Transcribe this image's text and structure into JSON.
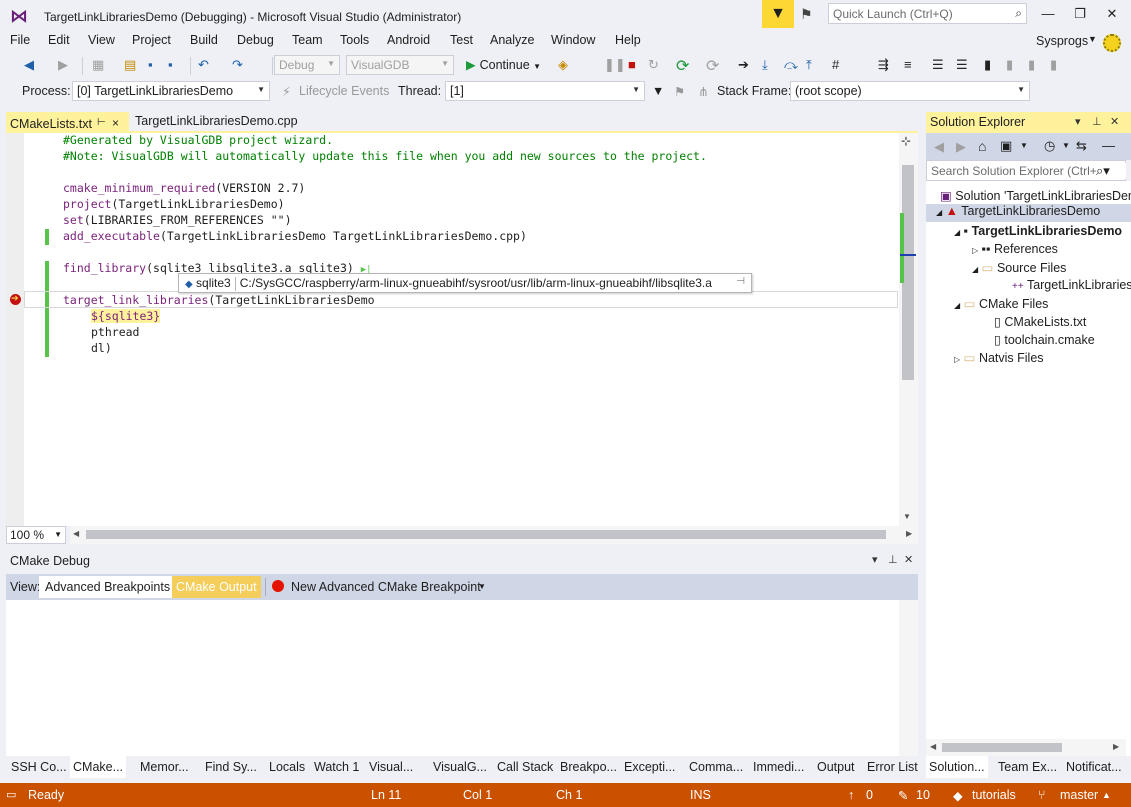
{
  "window": {
    "title": "TargetLinkLibrariesDemo (Debugging) - Microsoft Visual Studio  (Administrator)",
    "quick_launch_placeholder": "Quick Launch (Ctrl+Q)",
    "account": "Sysprogs"
  },
  "menu": [
    "File",
    "Edit",
    "View",
    "Project",
    "Build",
    "Debug",
    "Team",
    "Tools",
    "Android",
    "Test",
    "Analyze",
    "Window",
    "Help"
  ],
  "toolbar": {
    "config": "Debug",
    "platform": "VisualGDB",
    "continue_label": "Continue"
  },
  "debug_location": {
    "process_label": "Process:",
    "process_value": "[0] TargetLinkLibrariesDemo",
    "lifecycle_label": "Lifecycle Events",
    "thread_label": "Thread:",
    "thread_value": "[1]",
    "stack_frame_label": "Stack Frame:",
    "stack_frame_value": "(root scope)"
  },
  "tabs": {
    "active": "CMakeLists.txt",
    "inactive": "TargetLinkLibrariesDemo.cpp"
  },
  "code": {
    "line1": "#Generated by VisualGDB project wizard.",
    "line2": "#Note: VisualGDB will automatically update this file when you add new sources to the project.",
    "l4_fn": "cmake_minimum_required",
    "l4_rest": "(VERSION 2.7)",
    "l5_fn": "project",
    "l5_rest": "(TargetLinkLibrariesDemo)",
    "l6_fn": "set",
    "l6_rest": "(LIBRARIES_FROM_REFERENCES \"\")",
    "l7_fn": "add_executable",
    "l7_rest": "(TargetLinkLibrariesDemo TargetLinkLibrariesDemo.cpp)",
    "l9_fn": "find_library",
    "l9_rest": "(sqlite3 libsqlite3.a sqlite3)",
    "l11_fn": "target_link_libraries",
    "l11_rest": "(TargetLinkLibrariesDemo",
    "l12": "${sqlite3}",
    "l13": "pthread",
    "l14": "dl)"
  },
  "tooltip": {
    "name": "sqlite3",
    "value": "C:/SysGCC/raspberry/arm-linux-gnueabihf/sysroot/usr/lib/arm-linux-gnueabihf/libsqlite3.a"
  },
  "zoom": "100 %",
  "cmake_debug": {
    "title": "CMake Debug",
    "view_label": "View:",
    "tab_breakpoints": "Advanced Breakpoints",
    "tab_output": "CMake Output",
    "new_breakpoint": "New Advanced CMake Breakpoint"
  },
  "bottom_tabs": [
    "SSH Co...",
    "CMake...",
    "Memor...",
    "Find Sy...",
    "Locals",
    "Watch 1",
    "Visual...",
    "VisualG...",
    "Call Stack",
    "Breakpo...",
    "Excepti...",
    "Comma...",
    "Immedi...",
    "Output",
    "Error List"
  ],
  "solution_explorer": {
    "title": "Solution Explorer",
    "search_placeholder": "Search Solution Explorer (Ctrl+;)",
    "items": {
      "solution": "Solution 'TargetLinkLibrariesDemo'",
      "cmake_project": "TargetLinkLibrariesDemo",
      "project": "TargetLinkLibrariesDemo",
      "references": "References",
      "source_files": "Source Files",
      "source_file": "TargetLinkLibrariesDemo.cpp",
      "cmake_files": "CMake Files",
      "cmakelists": "CMakeLists.txt",
      "toolchain": "toolchain.cmake",
      "natvis": "Natvis Files"
    },
    "tabs": [
      "Solution...",
      "Team Ex...",
      "Notificat..."
    ]
  },
  "status": {
    "state": "Ready",
    "line": "Ln 11",
    "col": "Col 1",
    "ch": "Ch 1",
    "mode": "INS",
    "up_count": "0",
    "edit_count": "10",
    "repo": "tutorials",
    "branch": "master"
  },
  "colors": {
    "status_bar": "#ca5100",
    "highlight_tab": "#fff29d",
    "breakpoint": "#c51010"
  }
}
